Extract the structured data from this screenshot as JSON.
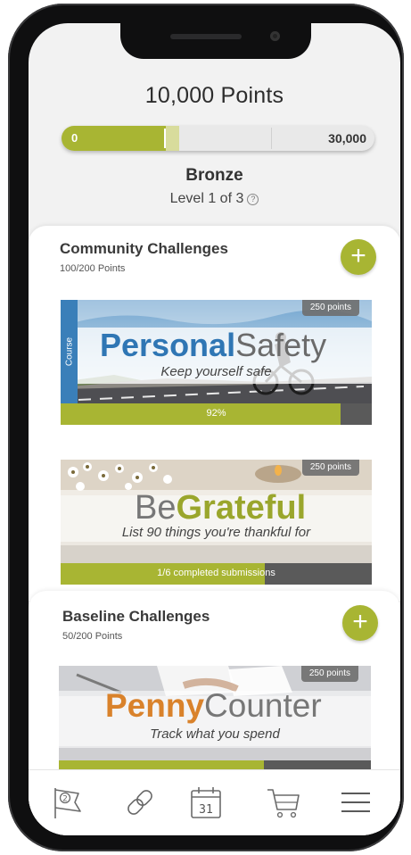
{
  "points": {
    "title": "10,000 Points",
    "min_label": "0",
    "max_label": "30,000",
    "progress_fraction": 0.3333
  },
  "tier": {
    "name": "Bronze",
    "level": "Level 1 of 3",
    "help_icon": "?"
  },
  "sections": [
    {
      "title": "Community Challenges",
      "subtitle": "100/200 Points",
      "add_label": "+",
      "challenges": [
        {
          "tag": "Course",
          "badge": "250 points",
          "title_bold": "Personal",
          "title_light": "Safety",
          "tagline": "Keep yourself safe",
          "progress_label": "92%",
          "progress": 0.92
        },
        {
          "badge": "250 points",
          "title_light": "Be",
          "title_bold": "Grateful",
          "tagline": "List 90 things you're thankful for",
          "progress_label": "1/6 completed submissions",
          "progress": 0.66
        }
      ]
    },
    {
      "title": "Baseline Challenges",
      "subtitle": "50/200 Points",
      "add_label": "+",
      "challenges": [
        {
          "badge": "250 points",
          "title_bold": "Penny",
          "title_light": "Counter",
          "tagline": "Track what you spend",
          "progress": 0.66
        }
      ]
    }
  ],
  "tabbar": {
    "icons": [
      "flag-icon",
      "link-icon",
      "calendar-icon",
      "cart-icon",
      "menu-icon"
    ],
    "flag_badge": "2",
    "calendar_day": "31"
  },
  "colors": {
    "accent": "#a8b533",
    "course_blue": "#3a7fb9",
    "personal_blue": "#2f76b4",
    "penny_orange": "#d9822b",
    "dark": "#2d2d2d"
  }
}
